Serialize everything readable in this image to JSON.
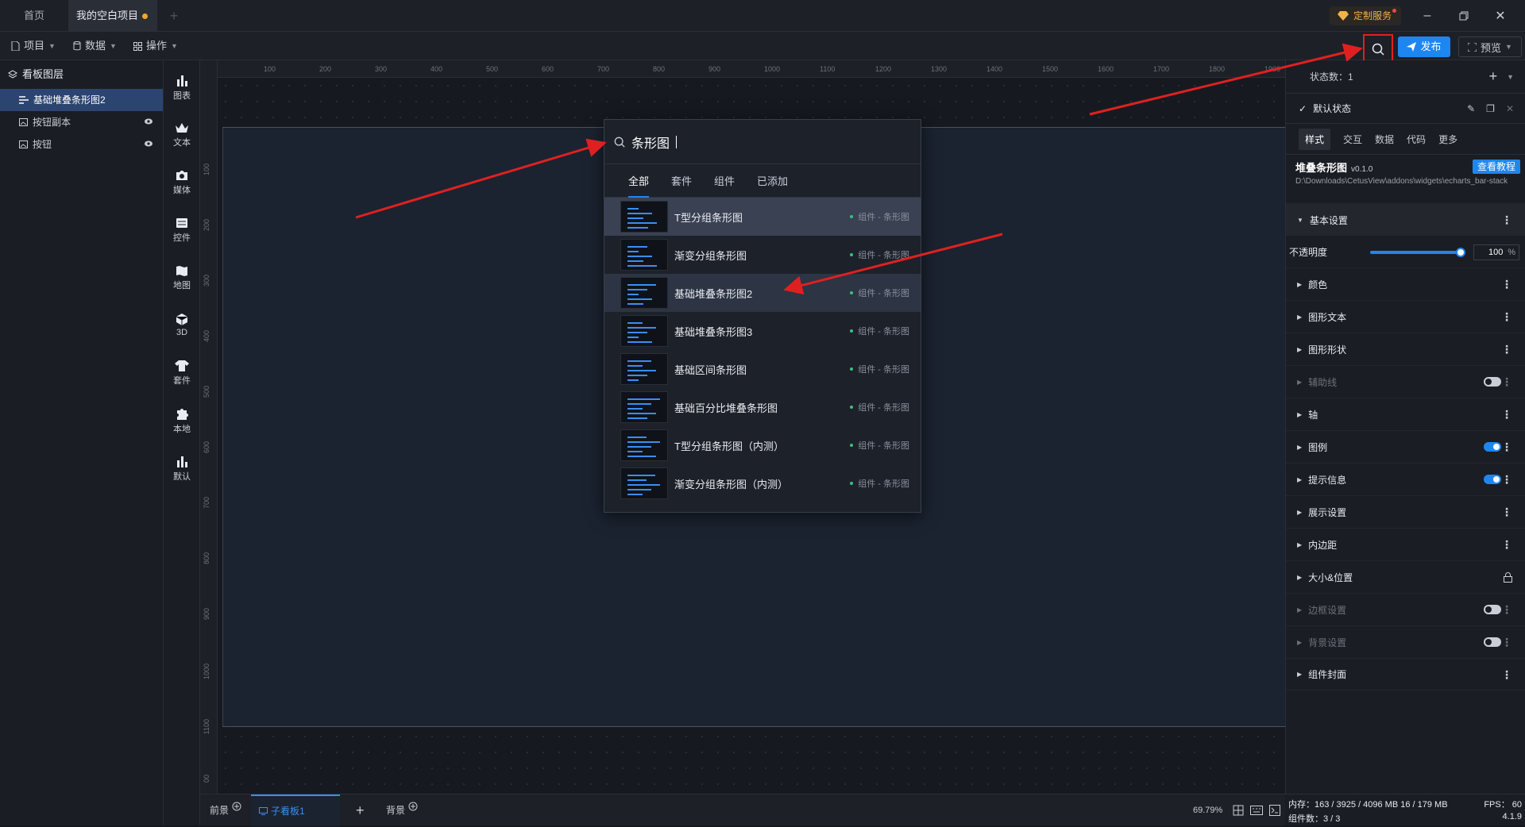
{
  "titlebar": {
    "tabs": [
      {
        "label": "首页"
      },
      {
        "label": "我的空白项目"
      }
    ],
    "custom_service": "定制服务"
  },
  "menubar": {
    "items": [
      {
        "label": "项目"
      },
      {
        "label": "数据"
      },
      {
        "label": "操作"
      }
    ],
    "publish": "发布",
    "preview": "预览"
  },
  "layers": {
    "title": "看板图层",
    "items": [
      {
        "label": "基础堆叠条形图2"
      },
      {
        "label": "按钮副本"
      },
      {
        "label": "按钮"
      }
    ]
  },
  "tools": [
    {
      "label": "图表",
      "icon": "bar-chart-icon"
    },
    {
      "label": "文本",
      "icon": "crown-icon"
    },
    {
      "label": "媒体",
      "icon": "camera-icon"
    },
    {
      "label": "控件",
      "icon": "widget-icon"
    },
    {
      "label": "地图",
      "icon": "map-icon"
    },
    {
      "label": "3D",
      "icon": "cube-icon"
    },
    {
      "label": "套件",
      "icon": "shirt-icon"
    },
    {
      "label": "本地",
      "icon": "puzzle-icon"
    },
    {
      "label": "默认",
      "icon": "bar-chart-icon"
    }
  ],
  "ruler": {
    "top": [
      "100",
      "200",
      "300",
      "400",
      "500",
      "600",
      "700",
      "800",
      "900",
      "1000",
      "1100",
      "1200",
      "1300",
      "1400",
      "1500",
      "1600",
      "1700",
      "1800",
      "1900"
    ],
    "left": [
      "100",
      "200",
      "300",
      "400",
      "500",
      "600",
      "700",
      "800",
      "900",
      "1000",
      "1100",
      "00"
    ]
  },
  "search_popup": {
    "query": "条形图",
    "tabs": [
      "全部",
      "套件",
      "组件",
      "已添加"
    ],
    "results": [
      {
        "name": "T型分组条形图",
        "tag": "组件 - 条形图"
      },
      {
        "name": "渐变分组条形图",
        "tag": "组件 - 条形图"
      },
      {
        "name": "基础堆叠条形图2",
        "tag": "组件 - 条形图"
      },
      {
        "name": "基础堆叠条形图3",
        "tag": "组件 - 条形图"
      },
      {
        "name": "基础区间条形图",
        "tag": "组件 - 条形图"
      },
      {
        "name": "基础百分比堆叠条形图",
        "tag": "组件 - 条形图"
      },
      {
        "name": "T型分组条形图（内测）",
        "tag": "组件 - 条形图"
      },
      {
        "name": "渐变分组条形图（内测）",
        "tag": "组件 - 条形图"
      }
    ]
  },
  "bottombar": {
    "front": "前景",
    "sub_board": "子看板1",
    "background": "背景",
    "zoom": "69.79%"
  },
  "right_panel": {
    "state_count_label": "状态数：1",
    "default_state": "默认状态",
    "tabs": [
      "样式",
      "交互",
      "数据",
      "代码",
      "更多"
    ],
    "widget_name": "堆叠条形图",
    "widget_version": "v0.1.0",
    "tutorial": "查看教程",
    "widget_path": "D:\\Downloads\\CetusView\\addons\\widgets\\echarts_bar-stack",
    "basic_settings": "基本设置",
    "opacity_label": "不透明度",
    "opacity_value": "100",
    "opacity_unit": "%",
    "sections": [
      {
        "label": "颜色"
      },
      {
        "label": "图形文本"
      },
      {
        "label": "图形形状"
      },
      {
        "label": "辅助线"
      },
      {
        "label": "轴"
      },
      {
        "label": "图例"
      },
      {
        "label": "提示信息"
      },
      {
        "label": "展示设置"
      },
      {
        "label": "内边距"
      },
      {
        "label": "大小&位置"
      },
      {
        "label": "边框设置"
      },
      {
        "label": "背景设置"
      },
      {
        "label": "组件封面"
      }
    ]
  },
  "status": {
    "memory": "内存：163 / 3925 / 4096 MB  16 / 179 MB",
    "fps": "FPS： 60",
    "widget_count": "组件数：3 / 3",
    "version": "4.1.9"
  },
  "colors": {
    "accent": "#1e86f0",
    "annotation": "#e02020",
    "board": "#1b2330"
  }
}
